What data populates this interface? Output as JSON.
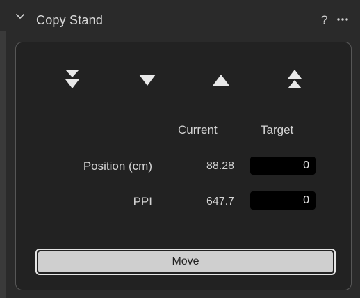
{
  "header": {
    "title": "Copy Stand",
    "help_label": "?",
    "collapse_icon": "chevron-down-icon",
    "more_icon": "more-dots-icon"
  },
  "controls": {
    "buttons": [
      {
        "icon": "double-down-arrow-icon"
      },
      {
        "icon": "down-arrow-icon"
      },
      {
        "icon": "up-arrow-icon"
      },
      {
        "icon": "double-up-arrow-icon"
      }
    ]
  },
  "table": {
    "col_current": "Current",
    "col_target": "Target",
    "rows": [
      {
        "label": "Position (cm)",
        "current": "88.28",
        "target": "0"
      },
      {
        "label": "PPI",
        "current": "647.7",
        "target": "0"
      }
    ]
  },
  "actions": {
    "move_label": "Move"
  },
  "colors": {
    "background": "#2a2a2a",
    "inner_panel": "#222222",
    "input_bg": "#000000",
    "button_bg": "#cfcfcf",
    "text": "#d4d4d4"
  }
}
